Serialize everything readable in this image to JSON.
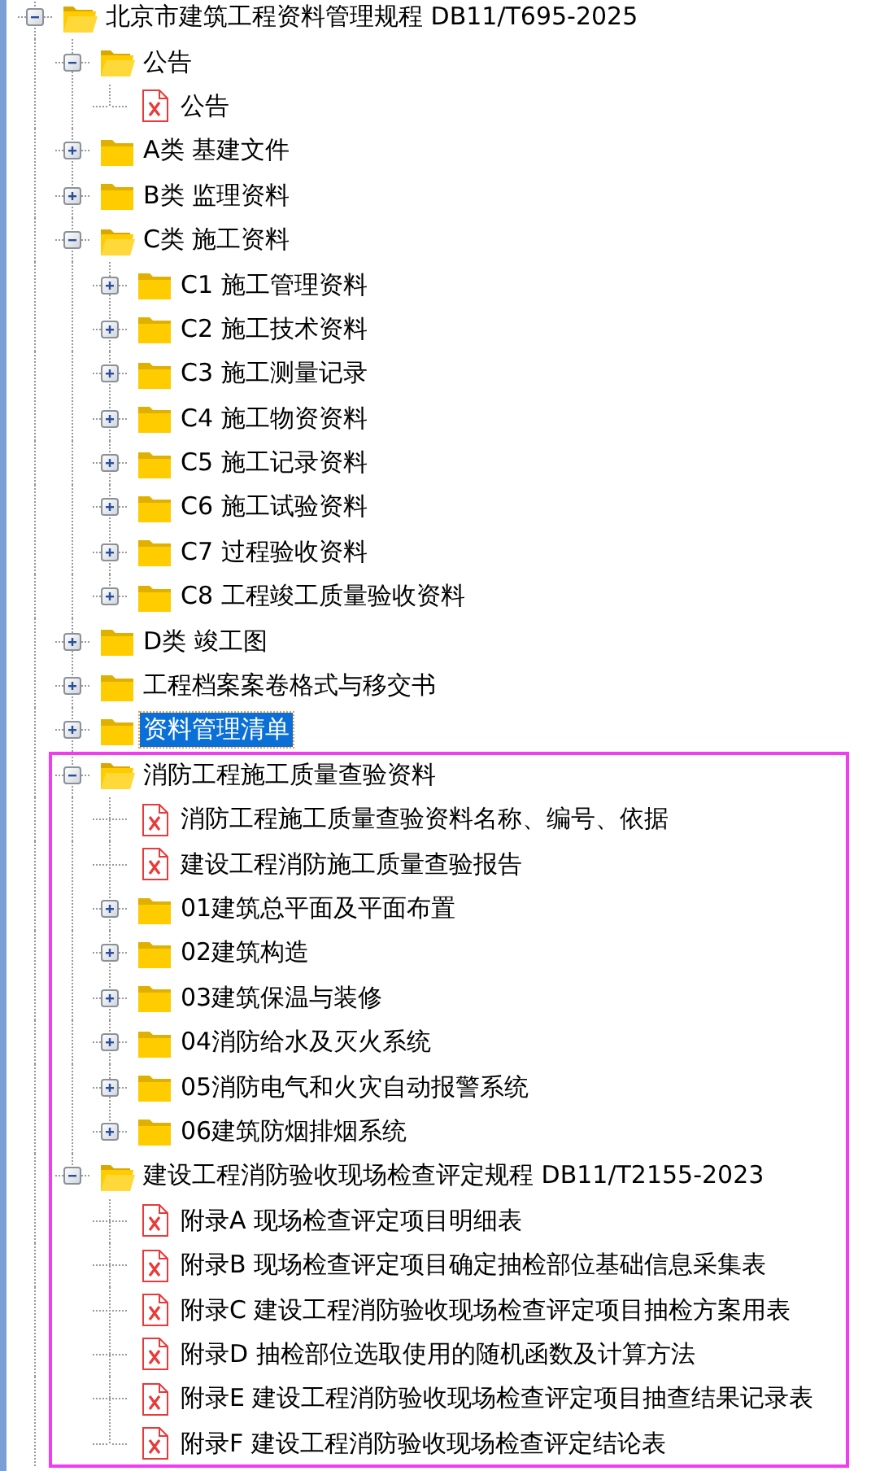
{
  "tree": [
    {
      "label": "北京市建筑工程资料管理规程 DB11/T695-2025",
      "kind": "folder",
      "expanded": true,
      "selected": false,
      "children": [
        {
          "label": "公告",
          "kind": "folder",
          "expanded": true,
          "selected": false,
          "children": [
            {
              "label": "公告",
              "kind": "file",
              "selected": false
            }
          ]
        },
        {
          "label": "A类 基建文件",
          "kind": "folder",
          "expanded": false,
          "selected": false
        },
        {
          "label": "B类 监理资料",
          "kind": "folder",
          "expanded": false,
          "selected": false
        },
        {
          "label": "C类 施工资料",
          "kind": "folder",
          "expanded": true,
          "selected": false,
          "children": [
            {
              "label": "C1 施工管理资料",
              "kind": "folder",
              "expanded": false,
              "selected": false
            },
            {
              "label": "C2 施工技术资料",
              "kind": "folder",
              "expanded": false,
              "selected": false
            },
            {
              "label": "C3 施工测量记录",
              "kind": "folder",
              "expanded": false,
              "selected": false
            },
            {
              "label": "C4 施工物资资料",
              "kind": "folder",
              "expanded": false,
              "selected": false
            },
            {
              "label": "C5 施工记录资料",
              "kind": "folder",
              "expanded": false,
              "selected": false
            },
            {
              "label": "C6 施工试验资料",
              "kind": "folder",
              "expanded": false,
              "selected": false
            },
            {
              "label": "C7 过程验收资料",
              "kind": "folder",
              "expanded": false,
              "selected": false
            },
            {
              "label": "C8 工程竣工质量验收资料",
              "kind": "folder",
              "expanded": false,
              "selected": false
            }
          ]
        },
        {
          "label": "D类 竣工图",
          "kind": "folder",
          "expanded": false,
          "selected": false
        },
        {
          "label": "工程档案案卷格式与移交书",
          "kind": "folder",
          "expanded": false,
          "selected": false
        },
        {
          "label": "资料管理清单",
          "kind": "folder",
          "expanded": false,
          "selected": true
        },
        {
          "label": "消防工程施工质量查验资料",
          "kind": "folder",
          "expanded": true,
          "selected": false,
          "children": [
            {
              "label": "消防工程施工质量查验资料名称、编号、依据",
              "kind": "file",
              "selected": false
            },
            {
              "label": "建设工程消防施工质量查验报告",
              "kind": "file",
              "selected": false
            },
            {
              "label": "01建筑总平面及平面布置",
              "kind": "folder",
              "expanded": false,
              "selected": false
            },
            {
              "label": "02建筑构造",
              "kind": "folder",
              "expanded": false,
              "selected": false
            },
            {
              "label": "03建筑保温与装修",
              "kind": "folder",
              "expanded": false,
              "selected": false
            },
            {
              "label": "04消防给水及灭火系统",
              "kind": "folder",
              "expanded": false,
              "selected": false
            },
            {
              "label": "05消防电气和火灾自动报警系统",
              "kind": "folder",
              "expanded": false,
              "selected": false
            },
            {
              "label": "06建筑防烟排烟系统",
              "kind": "folder",
              "expanded": false,
              "selected": false
            }
          ]
        },
        {
          "label": "建设工程消防验收现场检查评定规程 DB11/T2155-2023",
          "kind": "folder",
          "expanded": true,
          "selected": false,
          "children": [
            {
              "label": "附录A 现场检查评定项目明细表",
              "kind": "file",
              "selected": false
            },
            {
              "label": "附录B 现场检查评定项目确定抽检部位基础信息采集表",
              "kind": "file",
              "selected": false
            },
            {
              "label": "附录C 建设工程消防验收现场检查评定项目抽检方案用表",
              "kind": "file",
              "selected": false
            },
            {
              "label": "附录D 抽检部位选取使用的随机函数及计算方法",
              "kind": "file",
              "selected": false
            },
            {
              "label": "附录E 建设工程消防验收现场检查评定项目抽查结果记录表",
              "kind": "file",
              "selected": false
            },
            {
              "label": "附录F 建设工程消防验收现场检查评定结论表",
              "kind": "file",
              "selected": false
            }
          ]
        }
      ]
    }
  ]
}
